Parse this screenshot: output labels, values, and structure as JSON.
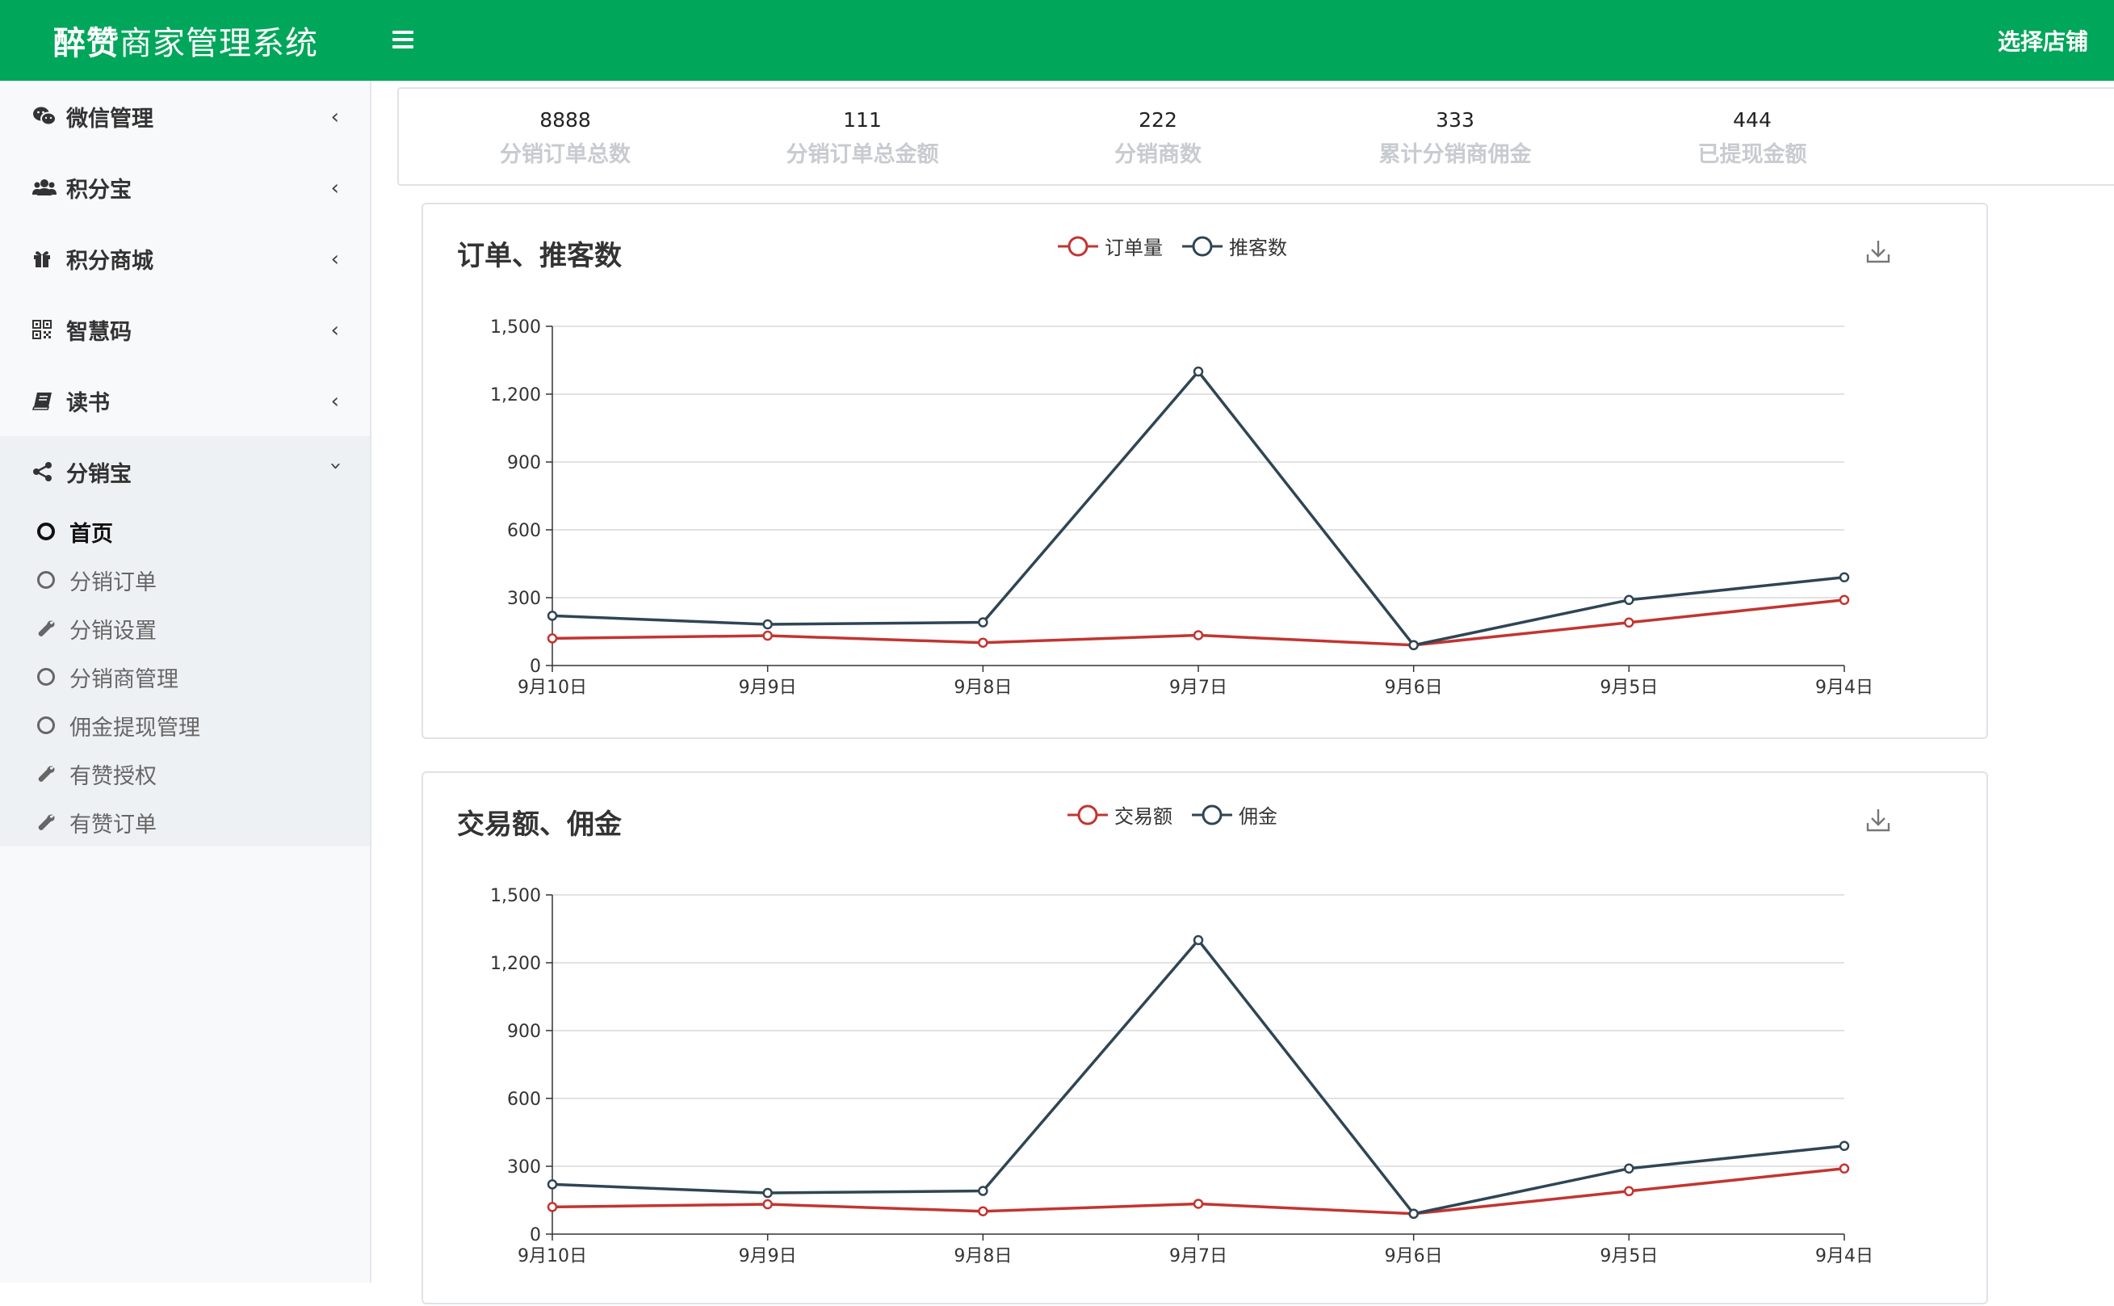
{
  "header": {
    "brand_bold": "醉赞",
    "brand_rest": "商家管理系统",
    "store_select": "选择店铺"
  },
  "sidebar": {
    "items": [
      {
        "label": "微信管理",
        "icon": "wechat-icon"
      },
      {
        "label": "积分宝",
        "icon": "users-icon"
      },
      {
        "label": "积分商城",
        "icon": "gift-icon"
      },
      {
        "label": "智慧码",
        "icon": "qrcode-icon"
      },
      {
        "label": "读书",
        "icon": "book-icon"
      },
      {
        "label": "分销宝",
        "icon": "share-icon"
      }
    ],
    "subitems": [
      {
        "label": "首页",
        "icon": "circle-icon",
        "active": true
      },
      {
        "label": "分销订单",
        "icon": "circle-icon"
      },
      {
        "label": "分销设置",
        "icon": "wrench-icon"
      },
      {
        "label": "分销商管理",
        "icon": "circle-icon"
      },
      {
        "label": "佣金提现管理",
        "icon": "circle-icon"
      },
      {
        "label": "有赞授权",
        "icon": "wrench-icon"
      },
      {
        "label": "有赞订单",
        "icon": "wrench-icon"
      }
    ]
  },
  "stats": [
    {
      "value": "8888",
      "label": "分销订单总数"
    },
    {
      "value": "111",
      "label": "分销订单总金额"
    },
    {
      "value": "222",
      "label": "分销商数"
    },
    {
      "value": "333",
      "label": "累计分销商佣金"
    },
    {
      "value": "444",
      "label": "已提现金额"
    }
  ],
  "colors": {
    "accent": "#00a65a",
    "series_red": "#c23531",
    "series_dark": "#2f4554"
  },
  "chart_data": [
    {
      "type": "line",
      "title": "订单、推客数",
      "categories": [
        "9月10日",
        "9月9日",
        "9月8日",
        "9月7日",
        "9月6日",
        "9月5日",
        "9月4日"
      ],
      "series": [
        {
          "name": "订单量",
          "values": [
            120,
            132,
            101,
            134,
            90,
            190,
            290
          ]
        },
        {
          "name": "推客数",
          "values": [
            220,
            182,
            191,
            1300,
            90,
            290,
            390
          ]
        }
      ],
      "yticks": [
        "0",
        "300",
        "600",
        "900",
        "1,200",
        "1,500"
      ],
      "ylim": [
        0,
        1500
      ],
      "grid": true,
      "legend": "top-center"
    },
    {
      "type": "line",
      "title": "交易额、佣金",
      "categories": [
        "9月10日",
        "9月9日",
        "9月8日",
        "9月7日",
        "9月6日",
        "9月5日",
        "9月4日"
      ],
      "series": [
        {
          "name": "交易额",
          "values": [
            120,
            132,
            101,
            134,
            90,
            190,
            290
          ]
        },
        {
          "name": "佣金",
          "values": [
            220,
            182,
            191,
            1300,
            90,
            290,
            390
          ]
        }
      ],
      "yticks": [
        "0",
        "300",
        "600",
        "900",
        "1,200",
        "1,500"
      ],
      "ylim": [
        0,
        1500
      ],
      "grid": true,
      "legend": "top-center"
    }
  ]
}
